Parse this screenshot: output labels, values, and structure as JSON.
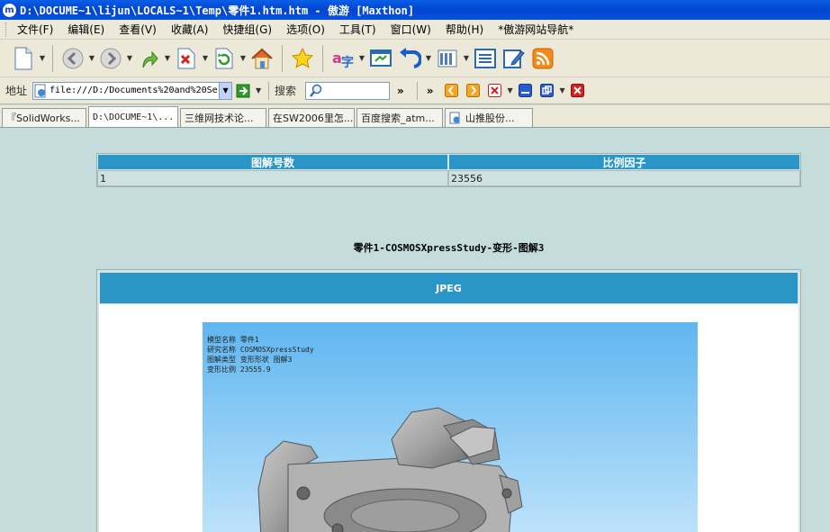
{
  "window": {
    "title": "D:\\DOCUME~1\\lijun\\LOCALS~1\\Temp\\零件1.htm.htm - 傲游 [Maxthon]"
  },
  "menu": {
    "items": [
      "文件(F)",
      "编辑(E)",
      "查看(V)",
      "收藏(A)",
      "快捷组(G)",
      "选项(O)",
      "工具(T)",
      "窗口(W)",
      "帮助(H)",
      "*傲游网站导航*"
    ]
  },
  "toolbar": {
    "icons": [
      "new-page-icon",
      "back-icon",
      "forward-icon",
      "up-icon",
      "stop-icon",
      "refresh-icon",
      "home-icon",
      "favorites-icon",
      "translate-icon",
      "screen-icon",
      "undo-icon",
      "columns-icon",
      "list-icon",
      "edit-icon",
      "rss-icon"
    ]
  },
  "address_bar": {
    "label": "地址",
    "url": "file:///D:/Documents%20and%20Se",
    "search_label": "搜索",
    "more": "»"
  },
  "tabs": [
    {
      "label": "『SolidWorks..."
    },
    {
      "label": "D:\\DOCUME~1\\..."
    },
    {
      "label": "三维网技术论..."
    },
    {
      "label": "在SW2006里怎..."
    },
    {
      "label": "百度搜索_atm..."
    },
    {
      "label": "山推股份..."
    }
  ],
  "content": {
    "table": {
      "headers": [
        "图解号数",
        "比例因子"
      ],
      "rows": [
        [
          "1",
          "23556"
        ]
      ]
    },
    "caption": "零件1-COSMOSXpressStudy-变形-图解3",
    "image_section": {
      "header": "JPEG",
      "legend": [
        "模型名称  零件1",
        "研究名称  COSMOSXpressStudy",
        "图解类型  变形形状 图解3",
        "变形比例  23555.9"
      ]
    }
  },
  "colors": {
    "titlebar": "#0045d0",
    "chrome": "#ece9d8",
    "page_bg": "#c5dcdc",
    "table_header": "#2a96c8"
  }
}
